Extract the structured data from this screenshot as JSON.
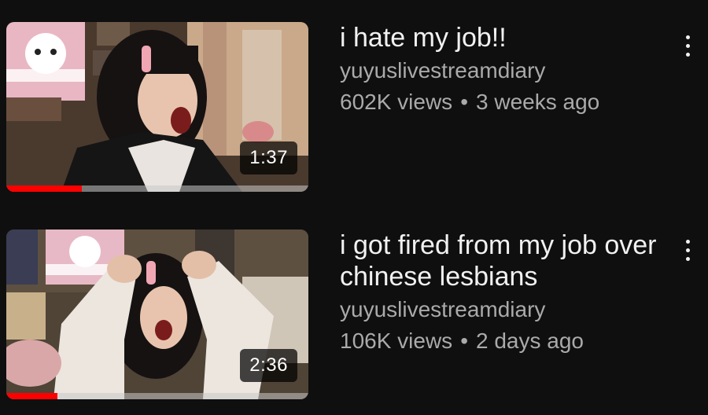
{
  "videos": [
    {
      "title": "i hate my job!!",
      "channel": "yuyuslivestreamdiary",
      "views": "602K views",
      "separator": "•",
      "age": "3 weeks ago",
      "duration": "1:37",
      "watch_progress": 0.25
    },
    {
      "title": "i got fired from my job over chinese lesbians",
      "channel": "yuyuslivestreamdiary",
      "views": "106K views",
      "separator": "•",
      "age": "2 days ago",
      "duration": "2:36",
      "watch_progress": 0.17
    }
  ],
  "colors": {
    "background": "#0f0f0f",
    "title": "#f1f1f1",
    "secondary_text": "#aaaaaa",
    "progress": "#ff0000"
  },
  "icons": {
    "menu": "more-vertical-icon"
  }
}
